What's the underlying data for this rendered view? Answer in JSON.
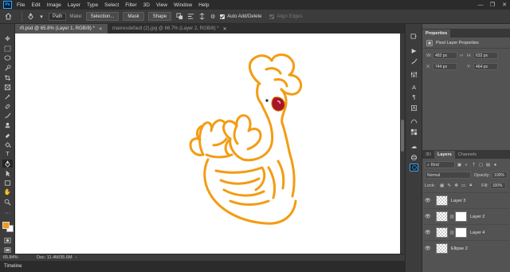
{
  "app": {
    "logo": "Ps"
  },
  "menu": [
    "File",
    "Edit",
    "Image",
    "Layer",
    "Type",
    "Select",
    "Filter",
    "3D",
    "View",
    "Window",
    "Help"
  ],
  "window_controls": {
    "minimize": "—",
    "restore": "❐",
    "close": "✕"
  },
  "options": {
    "mode": "Path",
    "make_label": "Make:",
    "selection_button": "Selection...",
    "mask_button": "Mask",
    "shape_button": "Shape",
    "auto_add_delete": "Auto Add/Delete",
    "align_edges": "Align Edges"
  },
  "tabs": [
    {
      "label": "rfi.psd @ 65.8% (Layer 1, RGB/8) *",
      "active": true
    },
    {
      "label": "maxresdefault (2).jpg @ 66.7% (Layer 2, RGB/8) *",
      "active": false
    }
  ],
  "status": {
    "zoom": "65.84%",
    "doc": "Doc: 11.4M/35.6M"
  },
  "timeline": {
    "label": "Timeline"
  },
  "properties": {
    "tab": "Properties",
    "title": "Pixel Layer Properties",
    "w_label": "W:",
    "w": "482 px",
    "h_label": "H:",
    "h": "632 px",
    "x_label": "X:",
    "x": "744 px",
    "y_label": "Y:",
    "y": "464 px"
  },
  "layers_panel": {
    "tabs": [
      "3D",
      "Layers",
      "Channels"
    ],
    "kind": "Kind",
    "blend_mode": "Normal",
    "opacity_label": "Opacity:",
    "opacity": "100%",
    "lock_label": "Lock:",
    "fill_label": "Fill:",
    "fill": "100%",
    "layers": [
      {
        "name": "Layer 3",
        "mask": false
      },
      {
        "name": "Layer 2",
        "mask": true
      },
      {
        "name": "Layer 4",
        "mask": true
      },
      {
        "name": "Ellipse 2",
        "mask": false
      }
    ]
  },
  "colors": {
    "foreground": "#f29a14",
    "background": "#ffffff",
    "stroke": "#f39c12",
    "accent": "#31a8ff"
  }
}
